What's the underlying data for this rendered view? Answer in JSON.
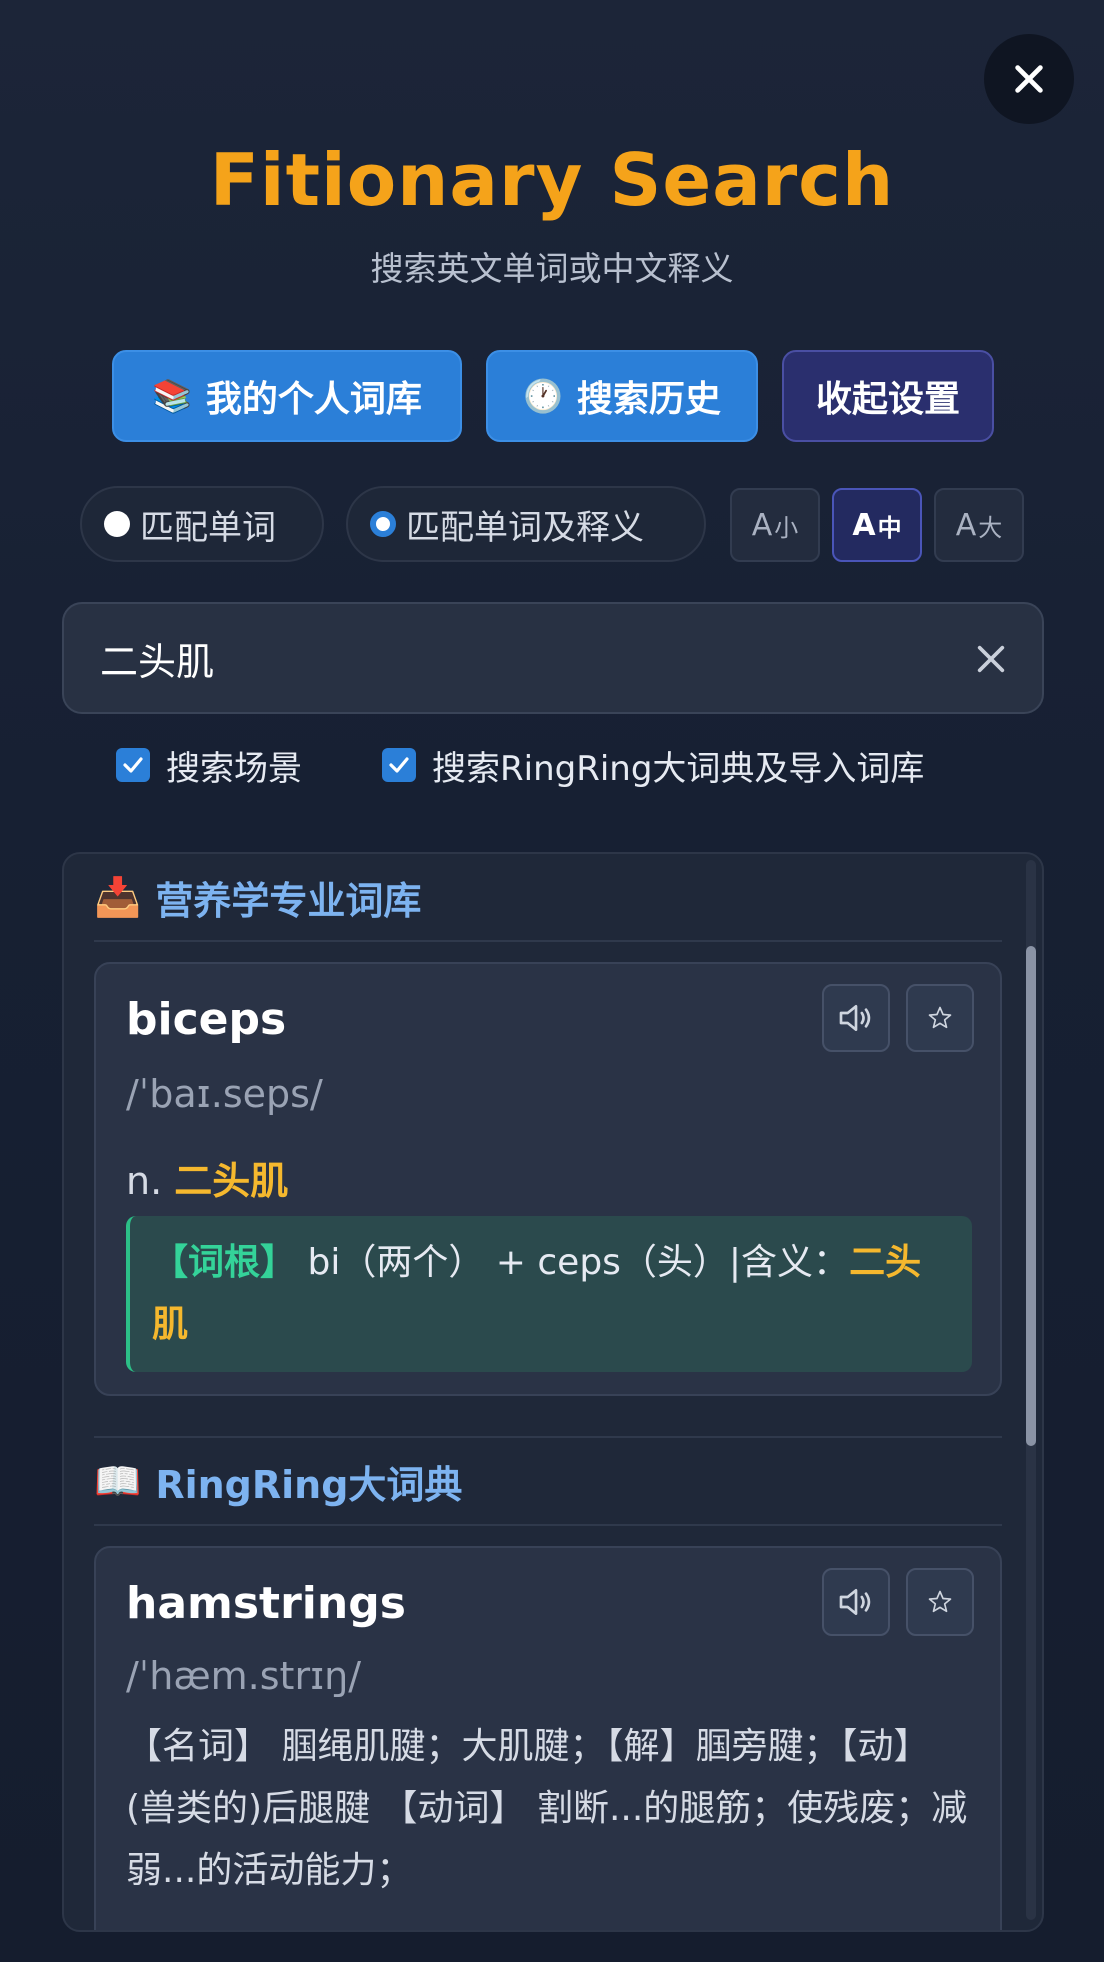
{
  "app": {
    "title": "Fitionary Search",
    "subtitle": "搜索英文单词或中文释义"
  },
  "toolbar": {
    "personal_vocab": {
      "icon": "📚",
      "label": "我的个人词库"
    },
    "history": {
      "icon": "🕐",
      "label": "搜索历史"
    },
    "collapse_settings": "收起设置"
  },
  "match_mode": {
    "word_only": "匹配单词",
    "word_and_def": "匹配单词及释义",
    "selected": "word_and_def"
  },
  "font_size": {
    "small": {
      "a": "A",
      "s": "小"
    },
    "medium": {
      "a": "A",
      "s": "中"
    },
    "large": {
      "a": "A",
      "s": "大"
    },
    "selected": "medium"
  },
  "search": {
    "value": "二头肌"
  },
  "options": {
    "scene": {
      "label": "搜索场景",
      "checked": true
    },
    "dict": {
      "label": "搜索RingRing大词典及导入词库",
      "checked": true
    }
  },
  "results": {
    "section1": {
      "icon": "📥",
      "title": "营养学专业词库",
      "entry": {
        "word": "biceps",
        "phonetic": "/ˈbaɪ.seps/",
        "pos": "n.",
        "meaning": "二头肌",
        "root_tag": "【词根】",
        "root_text": "bi（两个） + ceps（头）|含义：",
        "root_meaning": "二头肌"
      }
    },
    "section2": {
      "icon": "📖",
      "title": "RingRing大词典",
      "entry": {
        "word": "hamstrings",
        "phonetic": "/ˈhæm.strɪŋ/",
        "definition": "【名词】 腘绳肌腱；大肌腱；【解】腘旁腱；【动】(兽类的)后腿腱 【动词】 割断...的腿筋；使残废；减弱...的活动能力；"
      }
    }
  },
  "colors": {
    "accent": "#f5a31a",
    "primary_blue": "#2b7fd8",
    "section_title": "#7db3f0",
    "highlight": "#f5b82e",
    "root_tag": "#34d399"
  }
}
